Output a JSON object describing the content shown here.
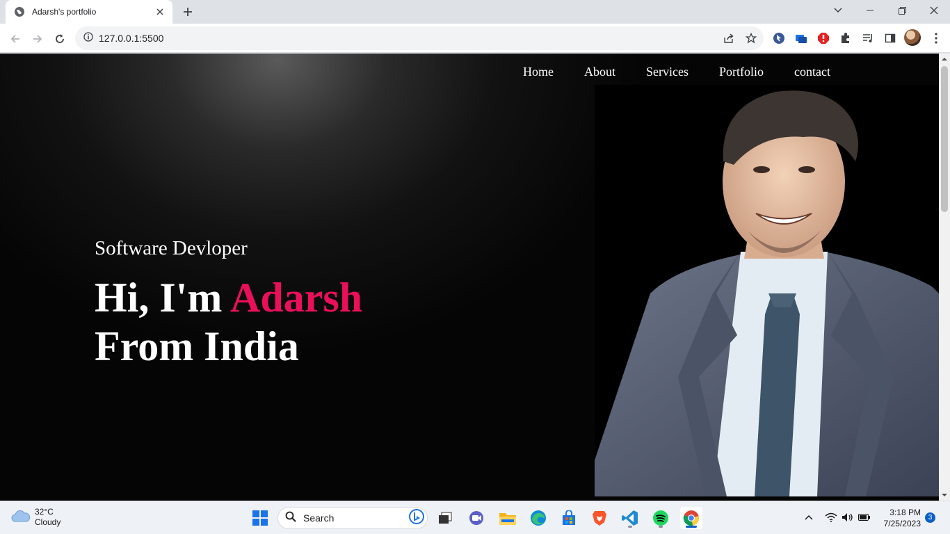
{
  "browser": {
    "tab_title": "Adarsh's portfolio",
    "url": "127.0.0.1:5500"
  },
  "page": {
    "nav": [
      "Home",
      "About",
      "Services",
      "Portfolio",
      "contact"
    ],
    "subtitle": "Software Devloper",
    "heading_prefix": "Hi, I'm ",
    "heading_name": "Adarsh",
    "heading_line2": "From India",
    "accent_color": "#ea0f5a"
  },
  "taskbar": {
    "weather_temp": "32°C",
    "weather_desc": "Cloudy",
    "search_label": "Search",
    "time": "3:18 PM",
    "date": "7/25/2023",
    "notification_count": "3"
  }
}
